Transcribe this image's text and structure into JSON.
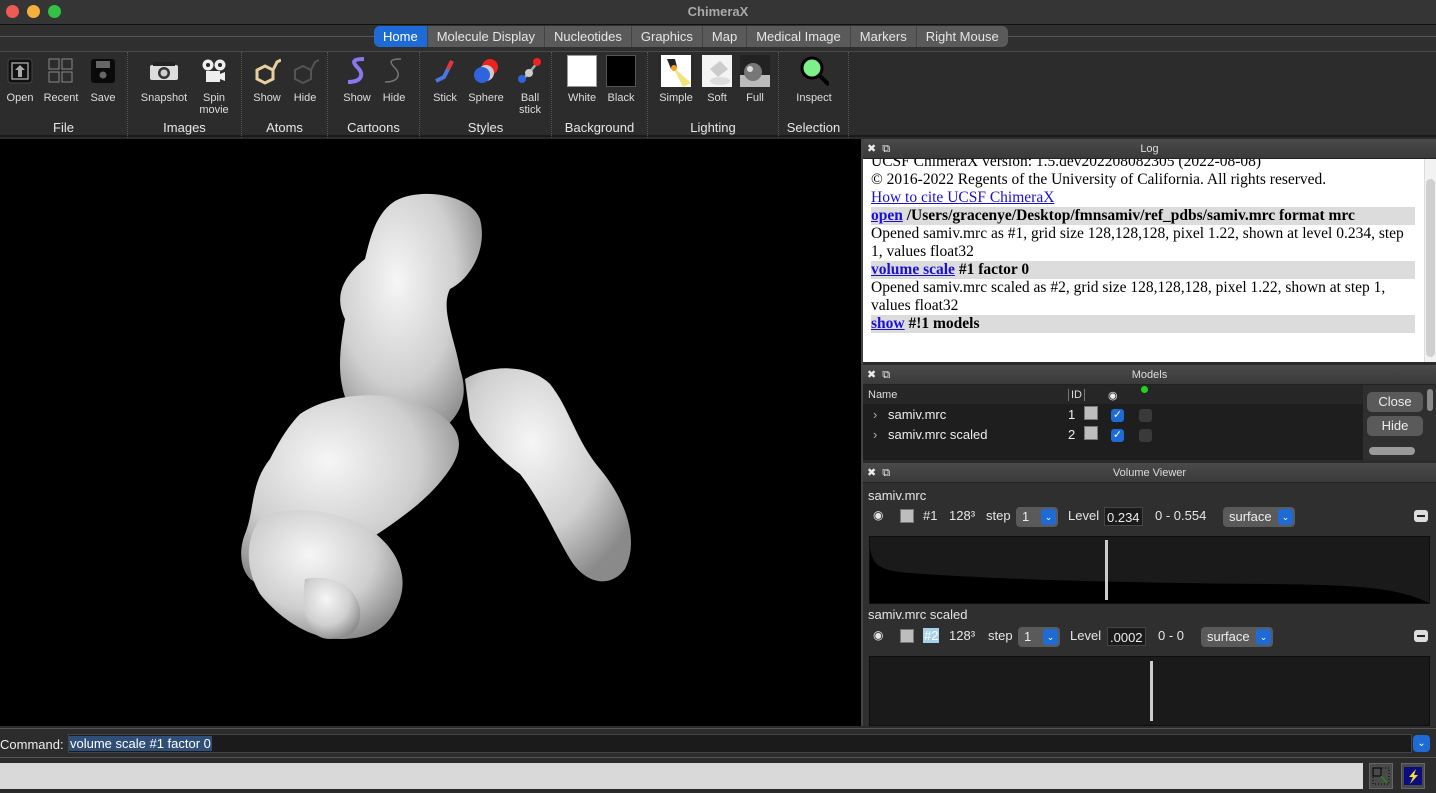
{
  "window": {
    "title": "ChimeraX"
  },
  "tabs": [
    {
      "label": "Home",
      "active": true
    },
    {
      "label": "Molecule Display"
    },
    {
      "label": "Nucleotides"
    },
    {
      "label": "Graphics"
    },
    {
      "label": "Map"
    },
    {
      "label": "Medical Image"
    },
    {
      "label": "Markers"
    },
    {
      "label": "Right Mouse"
    }
  ],
  "toolbar": {
    "groups": [
      {
        "label": "File",
        "buttons": [
          {
            "label": "Open",
            "icon": "open-icon"
          },
          {
            "label": "Recent",
            "icon": "recent-icon"
          },
          {
            "label": "Save",
            "icon": "save-icon"
          }
        ]
      },
      {
        "label": "Images",
        "buttons": [
          {
            "label": "Snapshot",
            "icon": "camera-icon"
          },
          {
            "label": "Spin movie",
            "icon": "movie-camera-icon"
          }
        ]
      },
      {
        "label": "Atoms",
        "buttons": [
          {
            "label": "Show",
            "icon": "atoms-show-icon"
          },
          {
            "label": "Hide",
            "icon": "atoms-hide-icon"
          }
        ]
      },
      {
        "label": "Cartoons",
        "buttons": [
          {
            "label": "Show",
            "icon": "cartoon-show-icon"
          },
          {
            "label": "Hide",
            "icon": "cartoon-hide-icon"
          }
        ]
      },
      {
        "label": "Styles",
        "buttons": [
          {
            "label": "Stick",
            "icon": "stick-icon"
          },
          {
            "label": "Sphere",
            "icon": "sphere-icon"
          },
          {
            "label": "Ball stick",
            "icon": "ball-stick-icon"
          }
        ]
      },
      {
        "label": "Background",
        "buttons": [
          {
            "label": "White",
            "icon": "white-swatch-icon"
          },
          {
            "label": "Black",
            "icon": "black-swatch-icon"
          }
        ]
      },
      {
        "label": "Lighting",
        "buttons": [
          {
            "label": "Simple",
            "icon": "spotlight-icon"
          },
          {
            "label": "Soft",
            "icon": "soft-light-icon"
          },
          {
            "label": "Full",
            "icon": "full-light-icon"
          }
        ]
      },
      {
        "label": "Selection",
        "buttons": [
          {
            "label": "Inspect",
            "icon": "magnifier-icon"
          }
        ]
      }
    ]
  },
  "log": {
    "title": "Log",
    "lines": {
      "version": "UCSF ChimeraX version: 1.5.dev202208082305 (2022-08-08)",
      "copyright": "© 2016-2022 Regents of the University of California. All rights reserved.",
      "cite_link": "How to cite UCSF ChimeraX",
      "cmd1_link": "open",
      "cmd1_rest": " /Users/gracenye/Desktop/fmnsamiv/ref_pdbs/samiv.mrc format mrc",
      "out1": "Opened samiv.mrc as #1, grid size 128,128,128, pixel 1.22, shown at level 0.234, step 1, values float32",
      "cmd2_link": "volume scale",
      "cmd2_rest": " #1 factor 0",
      "out2": "Opened samiv.mrc scaled as #2, grid size 128,128,128, pixel 1.22, shown at step 1, values float32",
      "cmd3_link": "show",
      "cmd3_rest": " #!1 models"
    }
  },
  "models": {
    "title": "Models",
    "columns": {
      "name": "Name",
      "id": "ID"
    },
    "rows": [
      {
        "name": "samiv.mrc",
        "id": "1",
        "shown": true
      },
      {
        "name": "samiv.mrc scaled",
        "id": "2",
        "shown": true
      }
    ],
    "buttons": {
      "close": "Close",
      "hide": "Hide"
    }
  },
  "volume_viewer": {
    "title": "Volume Viewer",
    "volumes": [
      {
        "name": "samiv.mrc",
        "id": "#1",
        "size": "128³",
        "step_label": "step",
        "step": "1",
        "level_label": "Level",
        "level": "0.234",
        "range": "0 - 0.554",
        "style": "surface",
        "level_fraction": 0.42
      },
      {
        "name": "samiv.mrc scaled",
        "id": "#2",
        "size": "128³",
        "step_label": "step",
        "step": "1",
        "level_label": "Level",
        "level": ".0002",
        "range": "0 - 0",
        "style": "surface",
        "level_fraction": 0.5
      }
    ]
  },
  "command": {
    "label": "Command:",
    "value": "volume scale #1 factor 0"
  },
  "colors": {
    "accent": "#1f6bd6",
    "link": "#1a0fd6"
  }
}
